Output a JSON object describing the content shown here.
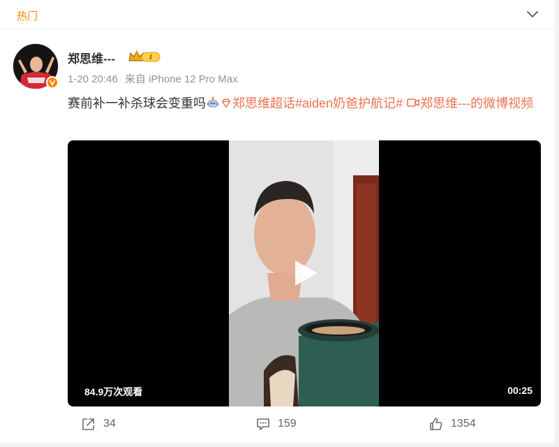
{
  "header": {
    "tab_label": "热门",
    "collapse_icon": "chevron-down-icon"
  },
  "post": {
    "author": "郑思维---",
    "vip_level": "1",
    "timestamp": "1-20 20:46",
    "source": "来自 iPhone 12 Pro Max",
    "text_plain": "赛前补一补杀球会变重吗",
    "supertopic_link": "郑思维超话",
    "hashtag_link": "#aiden奶爸护航记#",
    "video_link": "郑思维---的微博视频",
    "emoji_icon": "robot-emoji-icon",
    "supertopic_icon": "diamond-icon",
    "video_icon": "video-camera-icon"
  },
  "video": {
    "views": "84.9万次观看",
    "duration": "00:25",
    "play_icon": "play-icon"
  },
  "actions": {
    "repost_count": "34",
    "comment_count": "159",
    "like_count": "1354"
  },
  "colors": {
    "accent": "#ff8200",
    "link": "#eb7350",
    "text": "#333333",
    "meta": "#939393"
  }
}
